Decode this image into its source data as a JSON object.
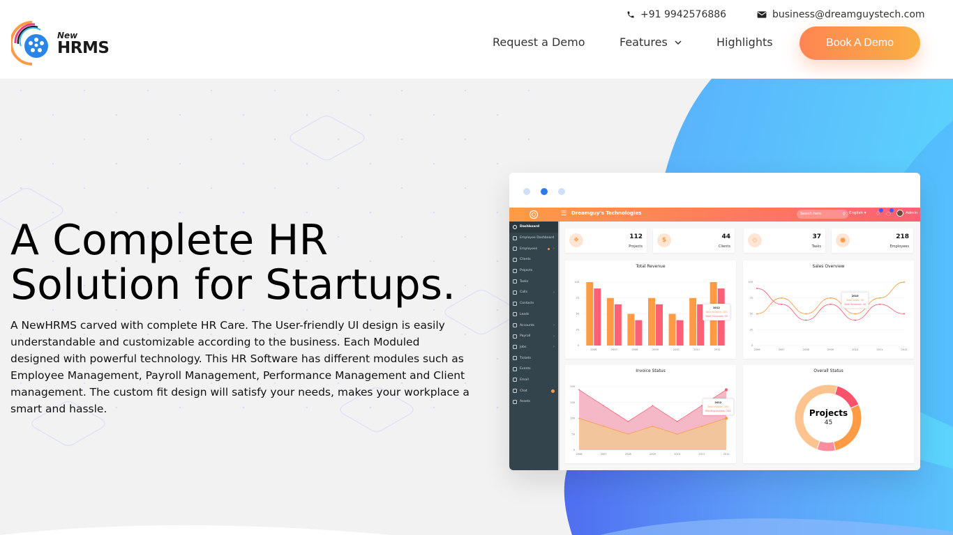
{
  "header": {
    "logo": {
      "small": "New",
      "big": "HRMS"
    },
    "phone": "+91 9942576886",
    "email": "business@dreamguystech.com",
    "nav": [
      {
        "label": "Request a Demo"
      },
      {
        "label": "Features"
      },
      {
        "label": "Highlights"
      }
    ],
    "cta": "Book A Demo"
  },
  "hero": {
    "title_line1": "A Complete HR",
    "title_line2": "Solution for Startups.",
    "description": "A NewHRMS carved with complete HR Care. The User-friendly UI design is easily understandable and customizable according to the business. Each Moduled designed with powerful technology. This HR Software has different modules such as Employee Management, Payroll Management, Performance Management and Client management. The custom fit design will satisfy your needs, makes your workplace a smart and hassle."
  },
  "carousel": {
    "slides": 3,
    "active_index": 1
  },
  "colors": {
    "orange": "#ff9b44",
    "pink": "#fc6075",
    "sidebar": "#34444c",
    "accent_blue": "#2c7af0"
  },
  "dashboard": {
    "company": "Dreamguy's Technologies",
    "search_placeholder": "Search here",
    "language": "English",
    "user": "Admin",
    "sidebar": [
      {
        "label": "Dashboard",
        "active": true
      },
      {
        "label": "Employee Dashboard"
      },
      {
        "label": "Employees",
        "chevron": true,
        "dot": true
      },
      {
        "label": "Clients"
      },
      {
        "label": "Projects"
      },
      {
        "label": "Tasks"
      },
      {
        "label": "Calls",
        "chevron": true
      },
      {
        "label": "Contacts"
      },
      {
        "label": "Leads"
      },
      {
        "label": "Accounts",
        "chevron": true
      },
      {
        "label": "Payroll",
        "chevron": true
      },
      {
        "label": "Jobs",
        "chevron": true
      },
      {
        "label": "Tickets"
      },
      {
        "label": "Events"
      },
      {
        "label": "Email"
      },
      {
        "label": "Chat",
        "badge": true
      },
      {
        "label": "Assets"
      }
    ],
    "stats": [
      {
        "value": "112",
        "label": "Projects",
        "icon": "cubes-icon"
      },
      {
        "value": "44",
        "label": "Clients",
        "icon": "dollar-icon"
      },
      {
        "value": "37",
        "label": "Tasks",
        "icon": "diamond-icon"
      },
      {
        "value": "218",
        "label": "Employees",
        "icon": "user-icon"
      }
    ]
  },
  "chart_data": [
    {
      "type": "bar",
      "title": "Total Revenue",
      "categories": [
        "2006",
        "2007",
        "2008",
        "2009",
        "2010",
        "2011",
        "2012"
      ],
      "series": [
        {
          "name": "Total Income",
          "values": [
            100,
            75,
            50,
            75,
            50,
            75,
            100
          ],
          "color": "#ff9b44"
        },
        {
          "name": "Total Outcome",
          "values": [
            90,
            65,
            40,
            65,
            40,
            65,
            90
          ],
          "color": "#fc6075"
        }
      ],
      "yticks": [
        0,
        25,
        50,
        75,
        100
      ],
      "ylim": [
        0,
        100
      ],
      "tooltip": {
        "year": "2012",
        "lines": [
          "Total Income: 100",
          "Total Outcome: 90"
        ]
      }
    },
    {
      "type": "line",
      "title": "Sales Overview",
      "categories": [
        "2006",
        "2007",
        "2008",
        "2009",
        "2010",
        "2011",
        "2012"
      ],
      "series": [
        {
          "name": "Total Sales",
          "values": [
            50,
            75,
            50,
            75,
            50,
            75,
            100
          ],
          "color": "#ff9b44"
        },
        {
          "name": "Total Revenue",
          "values": [
            90,
            65,
            40,
            65,
            40,
            65,
            50
          ],
          "color": "#fc6075"
        }
      ],
      "yticks": [
        0,
        25,
        50,
        75,
        100
      ],
      "ylim": [
        0,
        100
      ],
      "tooltip": {
        "year": "2010",
        "lines": [
          "Total Sales: 50",
          "Total Revenue: 40"
        ]
      }
    },
    {
      "type": "area",
      "title": "Invoice Status",
      "categories": [
        "2006",
        "2007",
        "2008",
        "2009",
        "2010",
        "2011",
        "2012"
      ],
      "series": [
        {
          "name": "Total Invoice",
          "values": [
            190,
            140,
            90,
            140,
            90,
            140,
            190
          ],
          "color": "#fc6075"
        },
        {
          "name": "Pending Invoice",
          "values": [
            100,
            75,
            50,
            75,
            50,
            75,
            100
          ],
          "color": "#ff9b44"
        }
      ],
      "yticks": [
        0,
        50,
        100,
        150,
        200
      ],
      "ylim": [
        0,
        200
      ],
      "tooltip": {
        "year": "2012",
        "lines": [
          "Total Invoice: 190",
          "Pending Invoice: 100"
        ]
      }
    },
    {
      "type": "pie",
      "title": "Overall Status",
      "center_title": "Projects",
      "center_value": "45",
      "slices": [
        {
          "value": 14,
          "color": "#f9526b"
        },
        {
          "value": 28,
          "color": "#ff9b44"
        },
        {
          "value": 9,
          "color": "#fd8c9e"
        },
        {
          "value": 49,
          "color": "#fdc48f"
        }
      ]
    }
  ]
}
